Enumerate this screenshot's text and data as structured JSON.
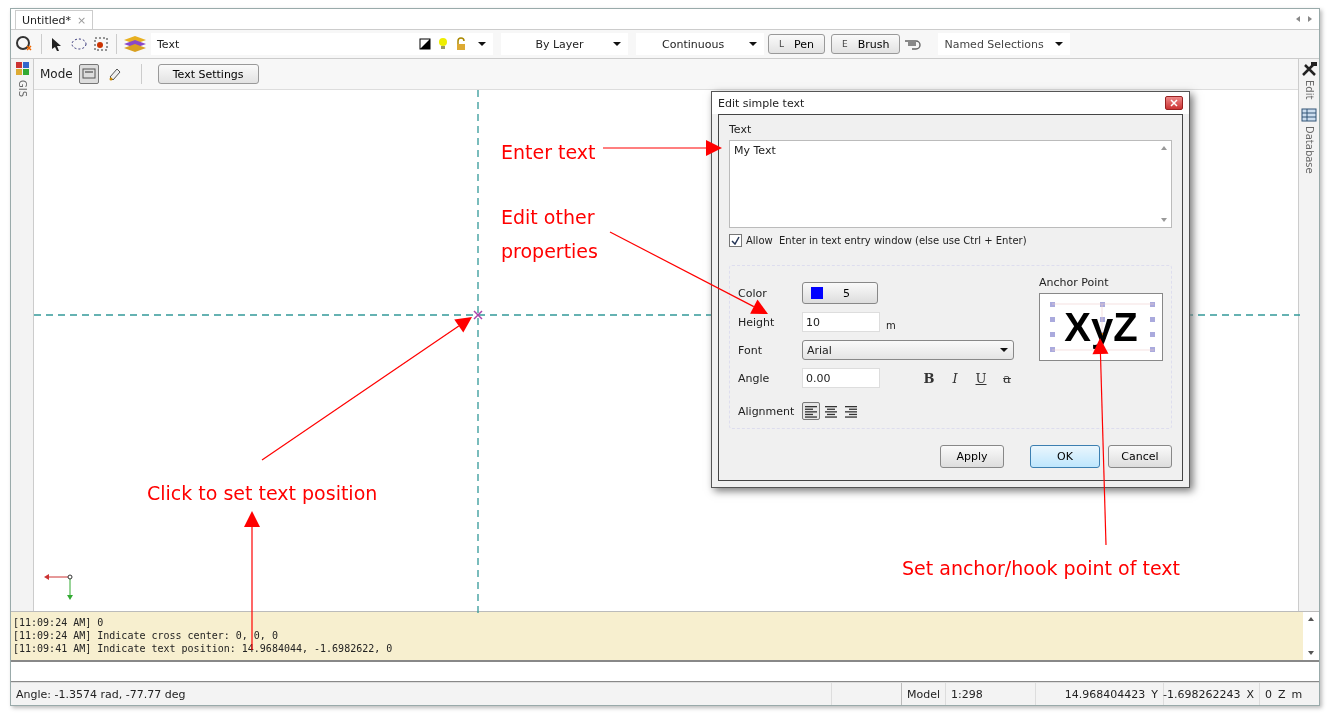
{
  "tabs": [
    {
      "label": "Untitled*",
      "close": "×",
      "selected": true
    }
  ],
  "toolbar": {
    "layer": "Text",
    "color_mode": "By Layer",
    "linetype": "Continuous",
    "pen": {
      "key": "L",
      "label": "Pen"
    },
    "brush": {
      "key": "E",
      "label": "Brush"
    },
    "named_selections": "Named Selections"
  },
  "left_panel": [
    "GIS"
  ],
  "right_panel": [
    {
      "label": "Edit",
      "kind": "tools"
    },
    {
      "label": "Database",
      "kind": "table"
    }
  ],
  "mode_bar": {
    "label": "Mode",
    "modes": [
      {
        "selected": true
      },
      {
        "selected": false
      }
    ],
    "button": "Text Settings"
  },
  "dialog": {
    "title": "Edit simple text",
    "text_label": "Text",
    "text_value": "My Text",
    "allow_enter": {
      "label": "Allow  Enter in text entry window (else use Ctrl + Enter)",
      "checked": true
    },
    "color_label": "Color",
    "color_value": "5",
    "color": "#0000ff",
    "height_label": "Height",
    "height_value": "10",
    "unit": "m",
    "font_label": "Font",
    "font_value": "Arial",
    "angle_label": "Angle",
    "angle_value": "0.00",
    "styles": [
      {
        "label": "B",
        "kind": "bold"
      },
      {
        "label": "I",
        "kind": "italic"
      },
      {
        "label": "U",
        "kind": "underline"
      },
      {
        "label": "a",
        "kind": "strike"
      }
    ],
    "alignment_label": "Alignment",
    "alignments": [
      {
        "kind": "left",
        "selected": true
      },
      {
        "kind": "center",
        "selected": false
      },
      {
        "kind": "right",
        "selected": false
      }
    ],
    "anchor_label": "Anchor Point",
    "anchor_sample": "XyZ",
    "buttons": [
      {
        "label": "Apply",
        "kind": "normal"
      },
      {
        "label": "OK",
        "kind": "default"
      },
      {
        "label": "Cancel",
        "kind": "normal"
      }
    ]
  },
  "annotations": [
    "Enter text",
    "Edit other\nproperties",
    "Click to set text position",
    "Set anchor/hook point of text"
  ],
  "log": [
    "[11:09:24 AM] 0",
    "[11:09:24 AM] Indicate cross center: 0, 0, 0",
    "[11:09:41 AM] Indicate text position: 14.9684044, -1.6982622, 0"
  ],
  "status_bar": {
    "angle": "Angle: -1.3574 rad, -77.77 deg",
    "space": "Model",
    "scale": "1:298",
    "y_value": "14.968404423",
    "y_label": "Y",
    "x_value": "-1.698262243",
    "x_label": "X",
    "z_value": "0",
    "z_label": "Z",
    "unit": "m"
  }
}
